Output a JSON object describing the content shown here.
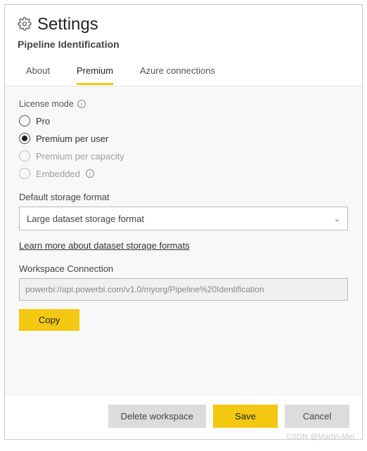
{
  "header": {
    "title": "Settings",
    "subtitle": "Pipeline Identification"
  },
  "tabs": {
    "about": "About",
    "premium": "Premium",
    "azure": "Azure connections"
  },
  "license": {
    "label": "License mode",
    "options": {
      "pro": "Pro",
      "premium_per_user": "Premium per user",
      "premium_per_capacity": "Premium per capacity",
      "embedded": "Embedded"
    }
  },
  "storage": {
    "label": "Default storage format",
    "value": "Large dataset storage format",
    "learn_more": "Learn more about dataset storage formats"
  },
  "workspace": {
    "label": "Workspace Connection",
    "value": "powerbi://api.powerbi.com/v1.0/myorg/Pipeline%20Identification",
    "copy": "Copy"
  },
  "footer": {
    "delete": "Delete workspace",
    "save": "Save",
    "cancel": "Cancel"
  },
  "watermark": "CSDN @Martin-Mei"
}
